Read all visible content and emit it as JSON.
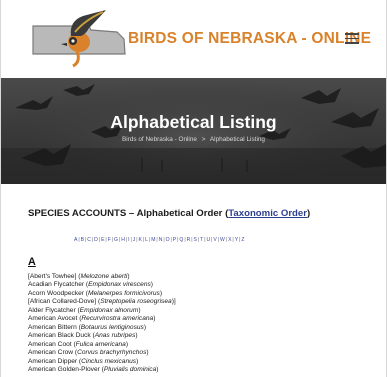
{
  "header": {
    "site_title": "BIRDS OF NEBRASKA - ONLINE",
    "menu_icon": "hamburger-menu-icon",
    "logo_icon": "nebraska-map-bird-logo"
  },
  "hero": {
    "title": "Alphabetical Listing",
    "breadcrumb": {
      "home": "Birds of Nebraska - Online",
      "separator": ">",
      "current": "Alphabetical Listing"
    }
  },
  "main": {
    "heading_prefix": "SPECIES ACCOUNTS – Alphabetical Order (",
    "heading_link": "Taxonomic Order",
    "heading_suffix": ")",
    "alphabet": [
      "A",
      "B",
      "C",
      "D",
      "E",
      "F",
      "G",
      "H",
      "I",
      "J",
      "K",
      "L",
      "M",
      "N",
      "O",
      "P",
      "Q",
      "R",
      "S",
      "T",
      "U",
      "V",
      "W",
      "X",
      "Y",
      "Z"
    ],
    "section_letter": "A",
    "species": [
      {
        "name": "[Abert's Towhee] (",
        "sci": "Melozone aberti",
        "end": ")"
      },
      {
        "name": "Acadian Flycatcher (",
        "sci": "Empidonax virescens",
        "end": ")"
      },
      {
        "name": "Acorn Woodpecker (",
        "sci": "Melanerpes formicivorus",
        "end": ")"
      },
      {
        "name": "[African Collared-Dove] (",
        "sci": "Streptopelia roseogrisea",
        "end": ")]"
      },
      {
        "name": "Alder Flycatcher (",
        "sci": "Empidonax alnorum",
        "end": ")"
      },
      {
        "name": "American Avocet (",
        "sci": "Recurvirostra americana",
        "end": ")"
      },
      {
        "name": "American Bittern (",
        "sci": "Botaurus lentiginosus",
        "end": ")"
      },
      {
        "name": "American Black Duck (",
        "sci": "Anas rubripes",
        "end": ")"
      },
      {
        "name": "American Coot (",
        "sci": "Fulica americana",
        "end": ")"
      },
      {
        "name": "American Crow (",
        "sci": "Corvus brachyrhynchos",
        "end": ")"
      },
      {
        "name": "American Dipper (",
        "sci": "Cinclus mexicanus",
        "end": ")"
      },
      {
        "name": "American Golden-Plover (",
        "sci": "Pluvialis dominica",
        "end": ")"
      }
    ]
  },
  "colors": {
    "title_orange": "#d9822b",
    "link_blue": "#2c3f8f"
  }
}
